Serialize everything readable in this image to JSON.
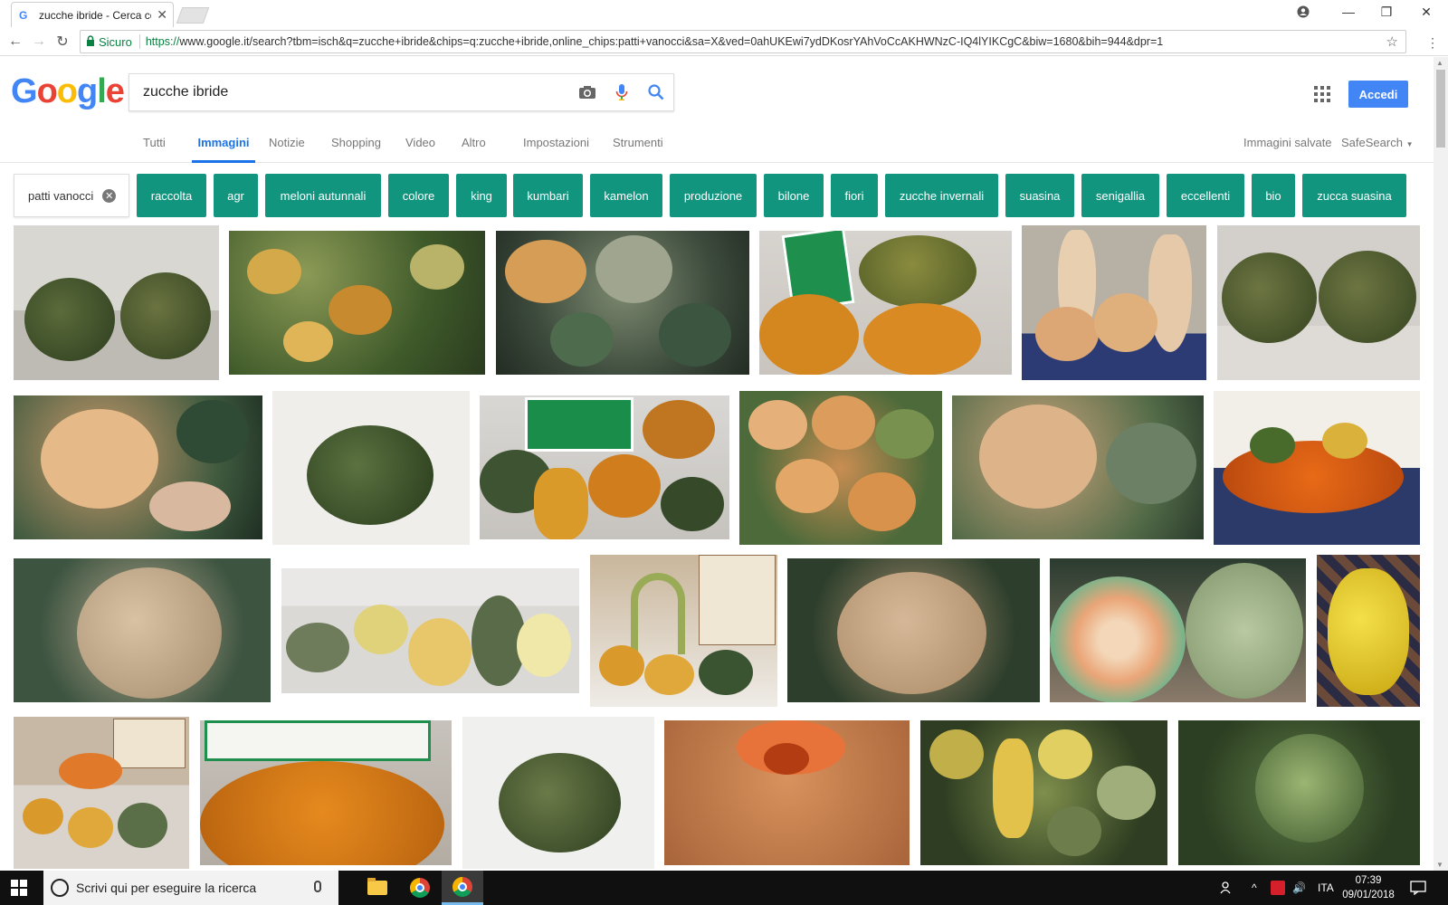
{
  "browser": {
    "tab_title": "zucche ibride - Cerca con Google",
    "tab_favicon": "G",
    "secure_label": "Sicuro",
    "url_prefix": "https://",
    "url_rest": "www.google.it/search?tbm=isch&q=zucche+ibride&chips=q:zucche+ibride,online_chips:patti+vanocci&sa=X&ved=0ahUKEwi7ydDKosrYAhVoCcAKHWNzC-IQ4lYIKCgC&biw=1680&bih=944&dpr=1"
  },
  "google": {
    "logo_letters": [
      "G",
      "o",
      "o",
      "g",
      "l",
      "e"
    ],
    "query": "zucche ibride",
    "signin_label": "Accedi"
  },
  "tabs": [
    "Tutti",
    "Immagini",
    "Notizie",
    "Shopping",
    "Video",
    "Altro",
    "Impostazioni",
    "Strumenti"
  ],
  "active_tab": "Immagini",
  "right_links": {
    "saved_images": "Immagini salvate",
    "safesearch": "SafeSearch"
  },
  "selected_chip": "patti vanocci",
  "chips": [
    "raccolta",
    "agr",
    "meloni autunnali",
    "colore",
    "king",
    "kumbari",
    "kamelon",
    "produzione",
    "bilone",
    "fiori",
    "zucche invernali",
    "suasina",
    "senigallia",
    "eccellenti",
    "bio",
    "zucca suasina"
  ],
  "colors": {
    "chip_bg": "#11957f",
    "accent_blue": "#4285f4",
    "active_tab": "#1a73e8"
  },
  "image_results": [
    "pumpkin-photo",
    "pumpkin-photo",
    "pumpkin-photo",
    "pumpkin-photo",
    "pumpkin-photo",
    "pumpkin-photo",
    "pumpkin-photo",
    "pumpkin-photo",
    "pumpkin-photo",
    "pumpkin-photo",
    "pumpkin-photo",
    "pumpkin-photo",
    "pumpkin-photo",
    "melon-photo",
    "pumpkin-photo",
    "pumpkin-photo",
    "melon-photo",
    "melon-photo",
    "pumpkin-photo",
    "pumpkin-photo",
    "pumpkin-photo",
    "pumpkin-photo",
    "pumpkin-photo",
    "pumpkin-photo"
  ],
  "taskbar": {
    "search_placeholder": "Scrivi qui per eseguire la ricerca",
    "language": "ITA",
    "time": "07:39",
    "date": "09/01/2018"
  }
}
